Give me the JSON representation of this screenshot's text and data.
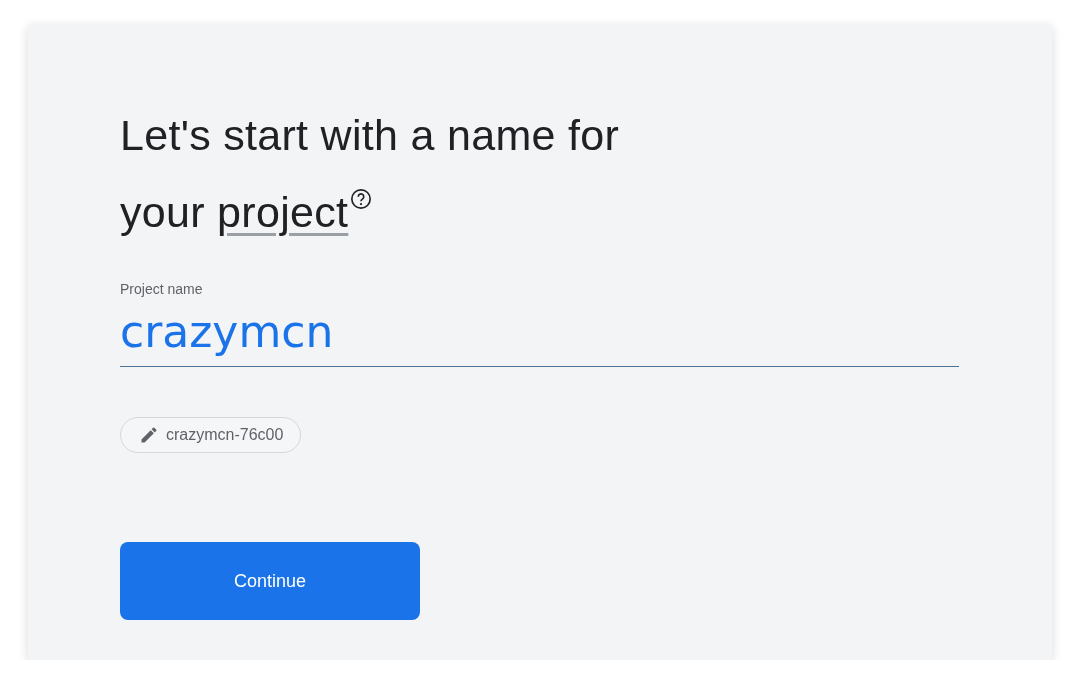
{
  "heading": {
    "text": "Let's start with a name for your",
    "link": "project"
  },
  "project_name": {
    "label": "Project name",
    "value": "crazymcn"
  },
  "project_id": {
    "value": "crazymcn-76c00"
  },
  "buttons": [
    {
      "label": "Continue",
      "kind": "primary"
    }
  ]
}
